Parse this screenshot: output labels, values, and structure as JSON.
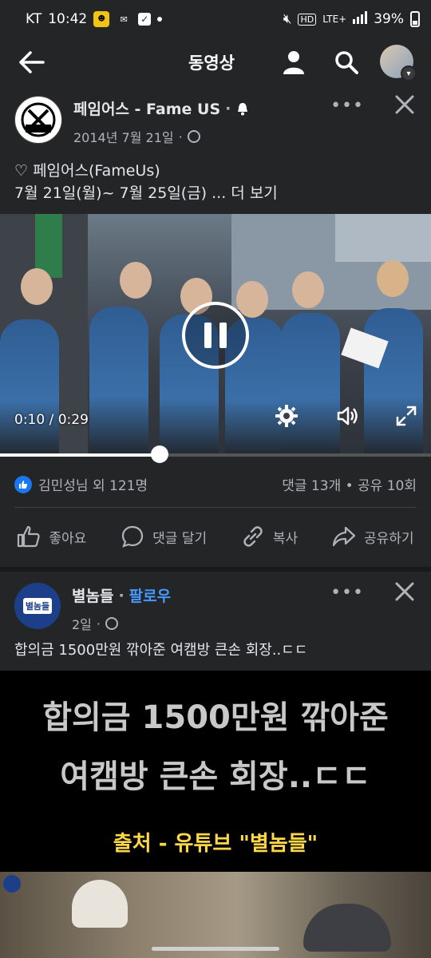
{
  "status_bar": {
    "carrier": "KT",
    "time": "10:42",
    "battery": "39%",
    "network": "LTE+"
  },
  "top_bar": {
    "title": "동영상"
  },
  "post1": {
    "author": "페임어스 - Fame US",
    "date": "2014년 7월 21일",
    "text_line1": "♡ 페임어스(FameUs)",
    "text_line2": "7월 21일(월)~ 7월 25일(금)  ... 더 보기",
    "video_time": "0:10 / 0:29",
    "video_progress": 0.37,
    "reactions": "김민성님 외 121명",
    "counts": "댓글 13개 • 공유 10회",
    "actions": {
      "like": "좋아요",
      "comment": "댓글 달기",
      "copy": "복사",
      "share": "공유하기"
    }
  },
  "post2": {
    "author": "별놈들",
    "follow": "팔로우",
    "date": "2일",
    "text": "합의금 1500만원 깎아준 여캠방 큰손 회장..ㄷㄷ",
    "thumb_line1": "합의금 1500만원 깎아준",
    "thumb_line2": "여캠방 큰손 회장..ㄷㄷ",
    "thumb_source": "출처 - 유튜브 \"별놈들\""
  }
}
